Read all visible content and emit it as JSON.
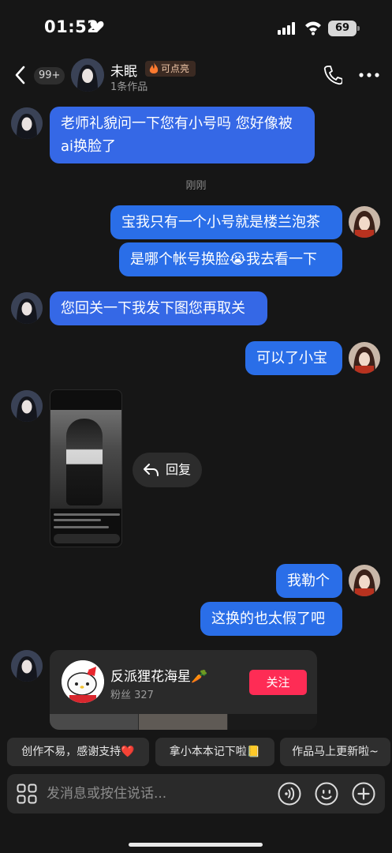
{
  "status_bar": {
    "time": "01:52",
    "battery": "69"
  },
  "header": {
    "unread_count": "99+",
    "contact_name": "未眠",
    "badge": "可点亮",
    "subtitle": "1条作品"
  },
  "messages": [
    {
      "side": "left",
      "text_lines": [
        "老师礼貌问一下您有小号吗 您好像被",
        "ai换脸了"
      ]
    },
    {
      "side": "center",
      "text": "刚刚"
    },
    {
      "side": "right",
      "text": "宝我只有一个小号就是楼兰泡茶"
    },
    {
      "side": "right",
      "text": "是哪个帐号换脸😭我去看一下"
    },
    {
      "side": "left",
      "text": "您回关一下我发下图您再取关"
    },
    {
      "side": "right",
      "text": "可以了小宝"
    },
    {
      "side": "left",
      "type": "image"
    },
    {
      "side": "right",
      "text": "我勒个"
    },
    {
      "side": "right",
      "text": "这换的也太假了吧"
    }
  ],
  "reply_button": "回复",
  "profile_card": {
    "name": "反派狸花海星🥕",
    "fans": "粉丝 327",
    "follow_label": "关注"
  },
  "quick_replies": [
    "创作不易，感谢支持❤️",
    "拿小本本记下啦📒",
    "作品马上更新啦~"
  ],
  "input": {
    "placeholder": "发消息或按住说话..."
  },
  "colors": {
    "background": "#161616",
    "bubble": "#3568e6",
    "follow": "#fe2c55",
    "quick_reply_bg": "#2e2e2e"
  },
  "icons": [
    "heart-icon",
    "signal-icon",
    "wifi-icon",
    "back-icon",
    "fire-icon",
    "phone-icon",
    "more-icon",
    "reply-icon",
    "grid-icon",
    "voice-icon",
    "emoji-icon",
    "plus-icon"
  ]
}
